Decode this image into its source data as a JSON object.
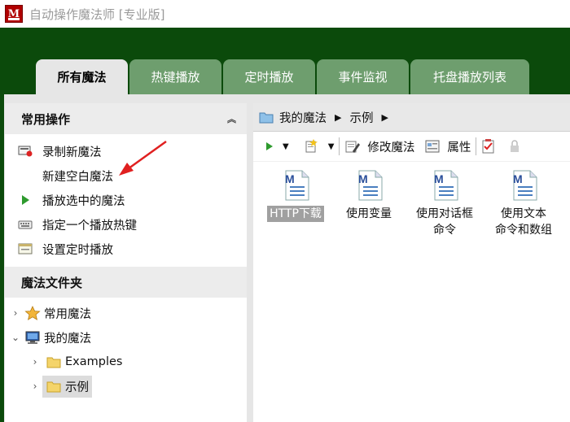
{
  "window": {
    "title": "自动操作魔法师 [专业版]",
    "app_icon_letter": "M"
  },
  "tabs": [
    {
      "label": "所有魔法",
      "active": true
    },
    {
      "label": "热键播放",
      "active": false
    },
    {
      "label": "定时播放",
      "active": false
    },
    {
      "label": "事件监视",
      "active": false
    },
    {
      "label": "托盘播放列表",
      "active": false
    }
  ],
  "common_ops": {
    "header": "常用操作",
    "items": [
      {
        "label": "录制新魔法",
        "icon": "record-icon"
      },
      {
        "label": "新建空白魔法",
        "icon": ""
      },
      {
        "label": "播放选中的魔法",
        "icon": "play-icon"
      },
      {
        "label": "指定一个播放热键",
        "icon": "keyboard-icon"
      },
      {
        "label": "设置定时播放",
        "icon": "schedule-icon"
      }
    ]
  },
  "folders": {
    "header": "魔法文件夹",
    "items": [
      {
        "label": "常用魔法",
        "icon": "star-icon",
        "expanded": false
      },
      {
        "label": "我的魔法",
        "icon": "computer-icon",
        "expanded": true
      },
      {
        "label": "Examples",
        "icon": "folder-icon",
        "expanded": false
      },
      {
        "label": "示例",
        "icon": "folder-icon",
        "expanded": false,
        "selected": true
      }
    ]
  },
  "path": {
    "segments": [
      "我的魔法",
      "示例"
    ]
  },
  "toolbar": {
    "modify_label": "修改魔法",
    "properties_label": "属性"
  },
  "files": [
    {
      "label": "HTTP下载",
      "selected": true
    },
    {
      "label": "使用变量",
      "selected": false
    },
    {
      "label": "使用对话框\n命令",
      "selected": false
    },
    {
      "label": "使用文本\n命令和数组",
      "selected": false
    }
  ],
  "colors": {
    "band": "#0b4a0b",
    "tab": "#6e9e6e",
    "tab_active": "#e6e6e6",
    "annotation_arrow": "#e02020"
  }
}
